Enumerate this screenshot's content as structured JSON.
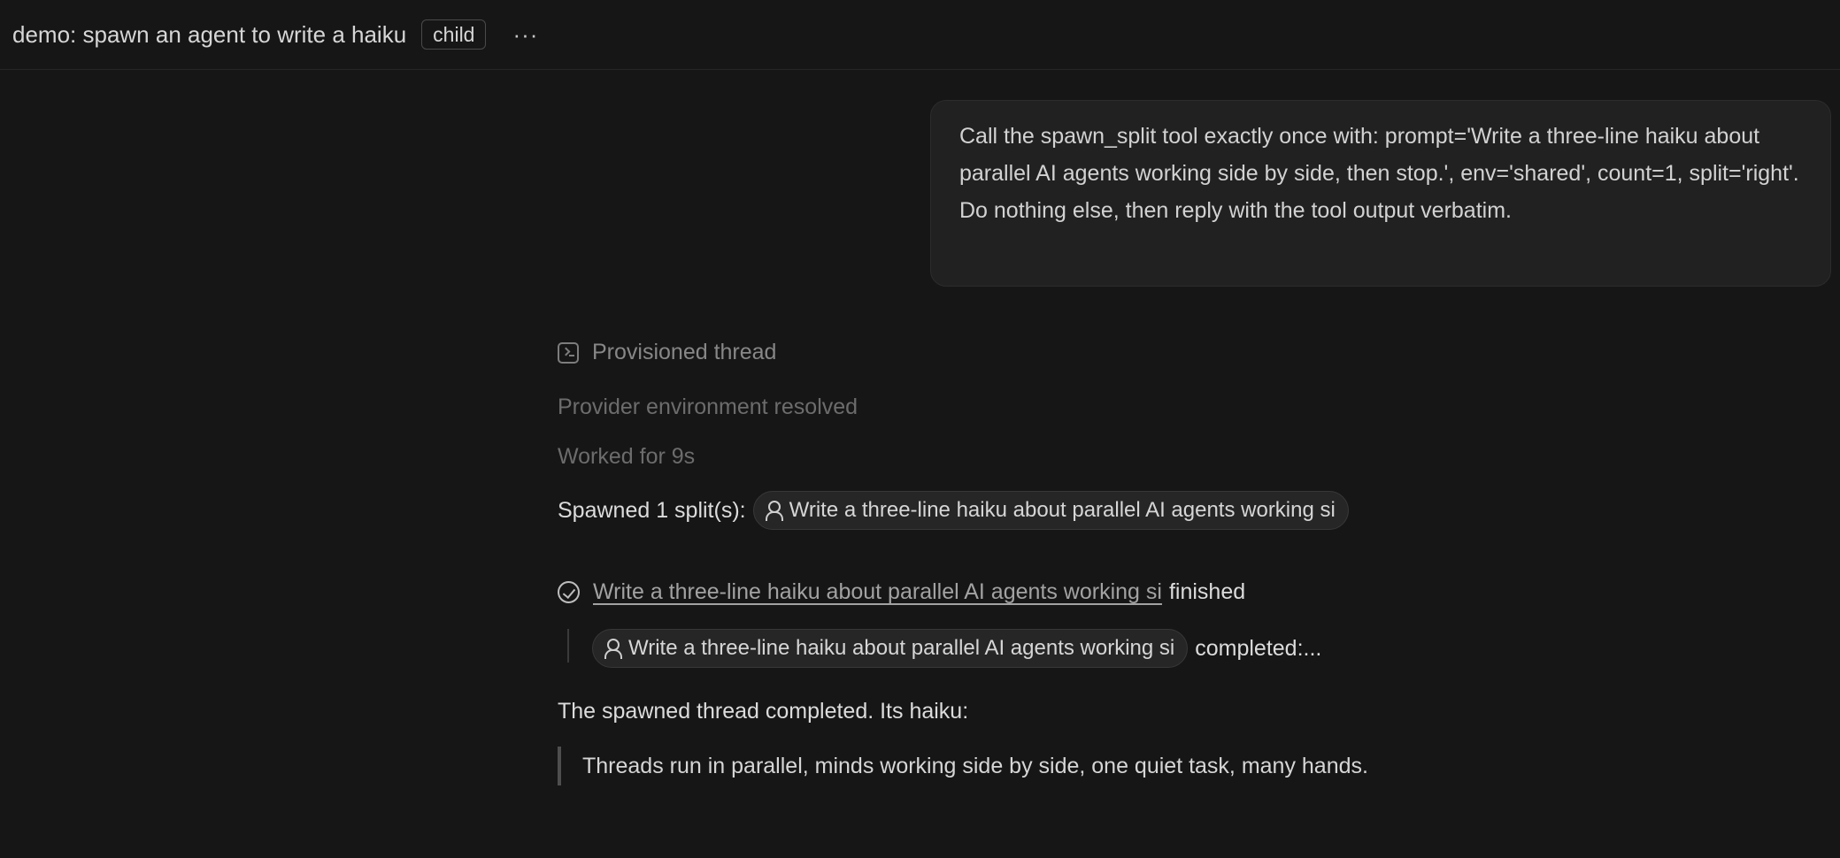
{
  "header": {
    "title": "demo: spawn an agent to write a haiku",
    "badge": "child",
    "more": "···"
  },
  "user_message": "Call the spawn_split tool exactly once with: prompt='Write a three-line haiku about parallel AI agents working side by side, then stop.', env='shared', count=1, split='right'. Do nothing else, then reply with the tool output verbatim.",
  "steps": {
    "provisioned": "Provisioned thread",
    "provider": "Provider environment resolved",
    "worked": "Worked for 9s",
    "spawned_label": "Spawned 1 split(s):",
    "spawned_chip": "Write a three-line haiku about parallel AI agents working si",
    "finished_link": "Write a three-line haiku about parallel AI agents working si",
    "finished_suffix": "finished",
    "nested_chip": "Write a three-line haiku about parallel AI agents working si",
    "nested_suffix": "completed:..."
  },
  "reply": {
    "summary": "The spawned thread completed. Its haiku:",
    "haiku": "Threads run in parallel, minds working side by side, one quiet task, many hands."
  },
  "icons": {
    "provisioned": "terminal-icon",
    "chip": "person-icon",
    "finished": "check-circle-icon"
  }
}
